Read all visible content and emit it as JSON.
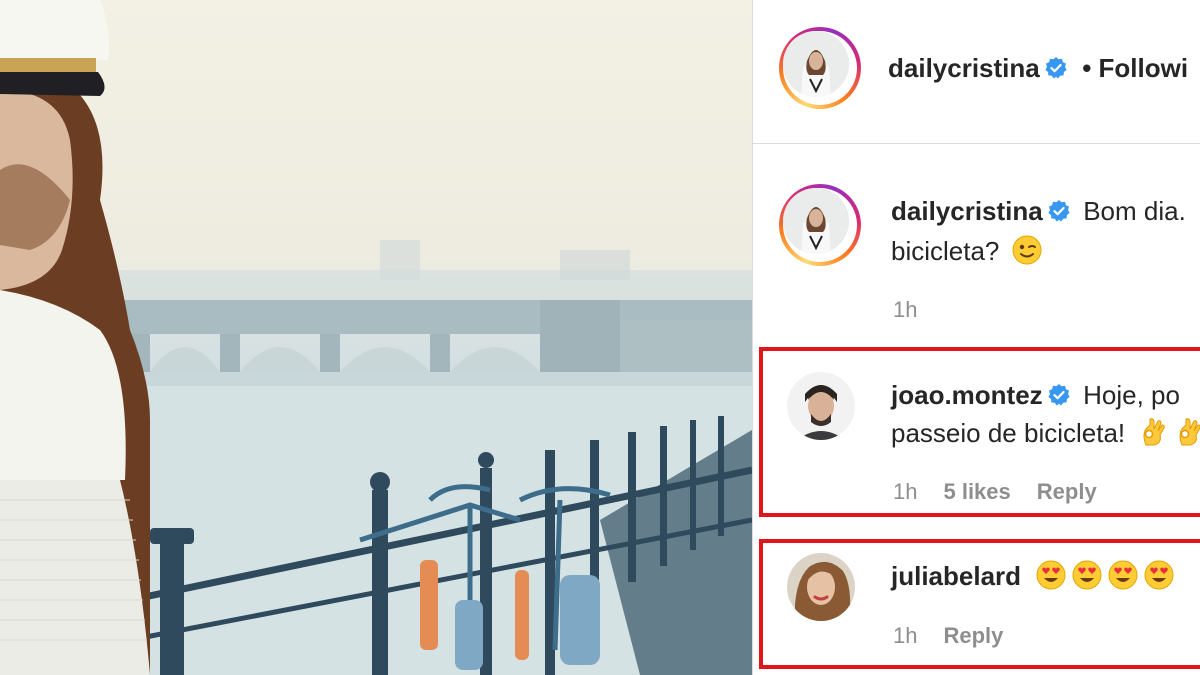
{
  "post": {
    "author": "dailycristina",
    "following_label": "• Followi"
  },
  "caption": {
    "username": "dailycristina",
    "text_line1": "Bom dia.",
    "text_line2": "bicicleta?",
    "time": "1h"
  },
  "comments": [
    {
      "username": "joao.montez",
      "text_line1": "Hoje, po",
      "text_line2": "passeio de bicicleta!",
      "time": "1h",
      "likes": "5 likes",
      "reply": "Reply",
      "highlighted": true
    },
    {
      "username": "juliabelard",
      "time": "1h",
      "reply": "Reply",
      "highlighted": true
    }
  ],
  "colors": {
    "highlight": "#e3151a",
    "verified": "#3897f0",
    "muted_text": "#8e8e8e"
  },
  "icons": [
    "verified-badge-icon",
    "winking-face-emoji",
    "ok-hand-emoji",
    "heart-eyes-emoji"
  ]
}
